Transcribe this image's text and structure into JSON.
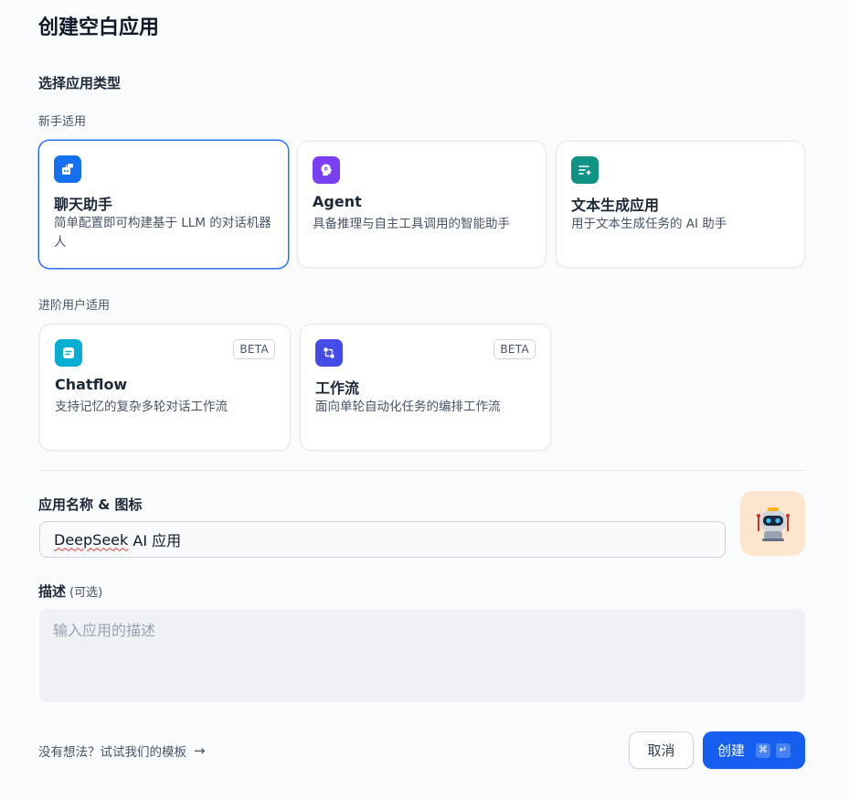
{
  "page": {
    "title": "创建空白应用",
    "section_title": "选择应用类型"
  },
  "groups": {
    "beginner_label": "新手适用",
    "advanced_label": "进阶用户适用"
  },
  "cards": {
    "chat": {
      "name": "聊天助手",
      "desc": "简单配置即可构建基于 LLM 的对话机器人",
      "icon": "chat-bot-icon",
      "color": "#1570ef"
    },
    "agent": {
      "name": "Agent",
      "desc": "具备推理与自主工具调用的智能助手",
      "icon": "agent-brain-icon",
      "color": "#7a3ff0"
    },
    "textgen": {
      "name": "文本生成应用",
      "desc": "用于文本生成任务的 AI 助手",
      "icon": "text-generate-icon",
      "color": "#0e9384"
    },
    "chatflow": {
      "name": "Chatflow",
      "desc": "支持记忆的复杂多轮对话工作流",
      "badge": "BETA",
      "icon": "chatflow-icon",
      "color": "#06aed4"
    },
    "workflow": {
      "name": "工作流",
      "desc": "面向单轮自动化任务的编排工作流",
      "badge": "BETA",
      "icon": "workflow-icon",
      "color": "#444ce7"
    }
  },
  "name_field": {
    "label": "应用名称 & 图标",
    "value_part1": "DeepSeek",
    "value_part2": " AI 应用"
  },
  "desc_field": {
    "label": "描述",
    "optional": "(可选)",
    "placeholder": "输入应用的描述"
  },
  "footer": {
    "template_link": "没有想法？试试我们的模板",
    "arrow": "→",
    "cancel": "取消",
    "create": "创建",
    "kbd_cmd": "⌘",
    "kbd_enter": "↵"
  },
  "colors": {
    "primary": "#155eef",
    "selected_border": "#2970ff",
    "avatar_bg": "#fde6cd"
  }
}
